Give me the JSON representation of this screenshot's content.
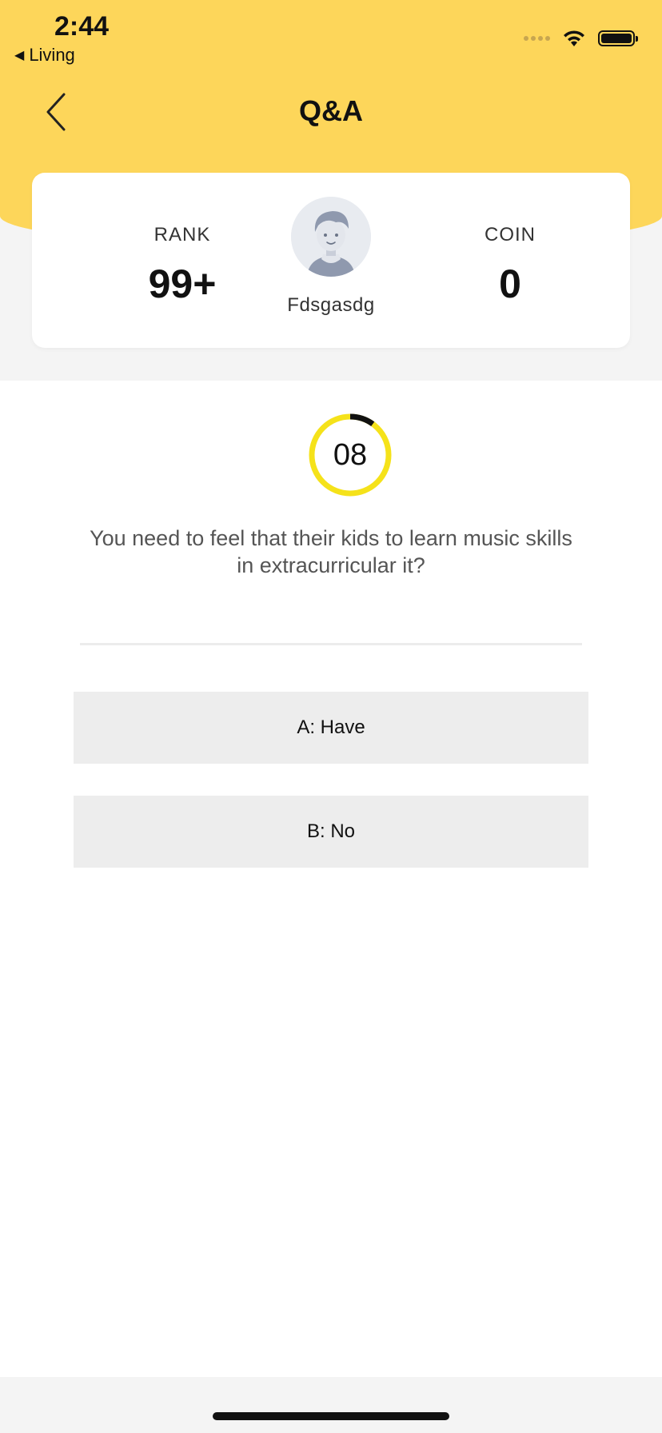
{
  "status_bar": {
    "time": "2:44",
    "back_app": "Living",
    "back_glyph": "◀"
  },
  "nav": {
    "title": "Q&A"
  },
  "profile": {
    "rank_label": "RANK",
    "rank_value": "99+",
    "coin_label": "COIN",
    "coin_value": "0",
    "username": "Fdsgasdg"
  },
  "quiz": {
    "timer": "08",
    "timer_remaining_fraction": 0.9,
    "question": "You need to feel that their kids to learn music skills in extracurricular it?",
    "options": [
      {
        "label": "A: Have"
      },
      {
        "label": "B: No"
      }
    ]
  },
  "colors": {
    "header": "#fdd65a",
    "timer_ring": "#f5e21a",
    "timer_elapsed": "#111111",
    "option_bg": "#ededed"
  }
}
